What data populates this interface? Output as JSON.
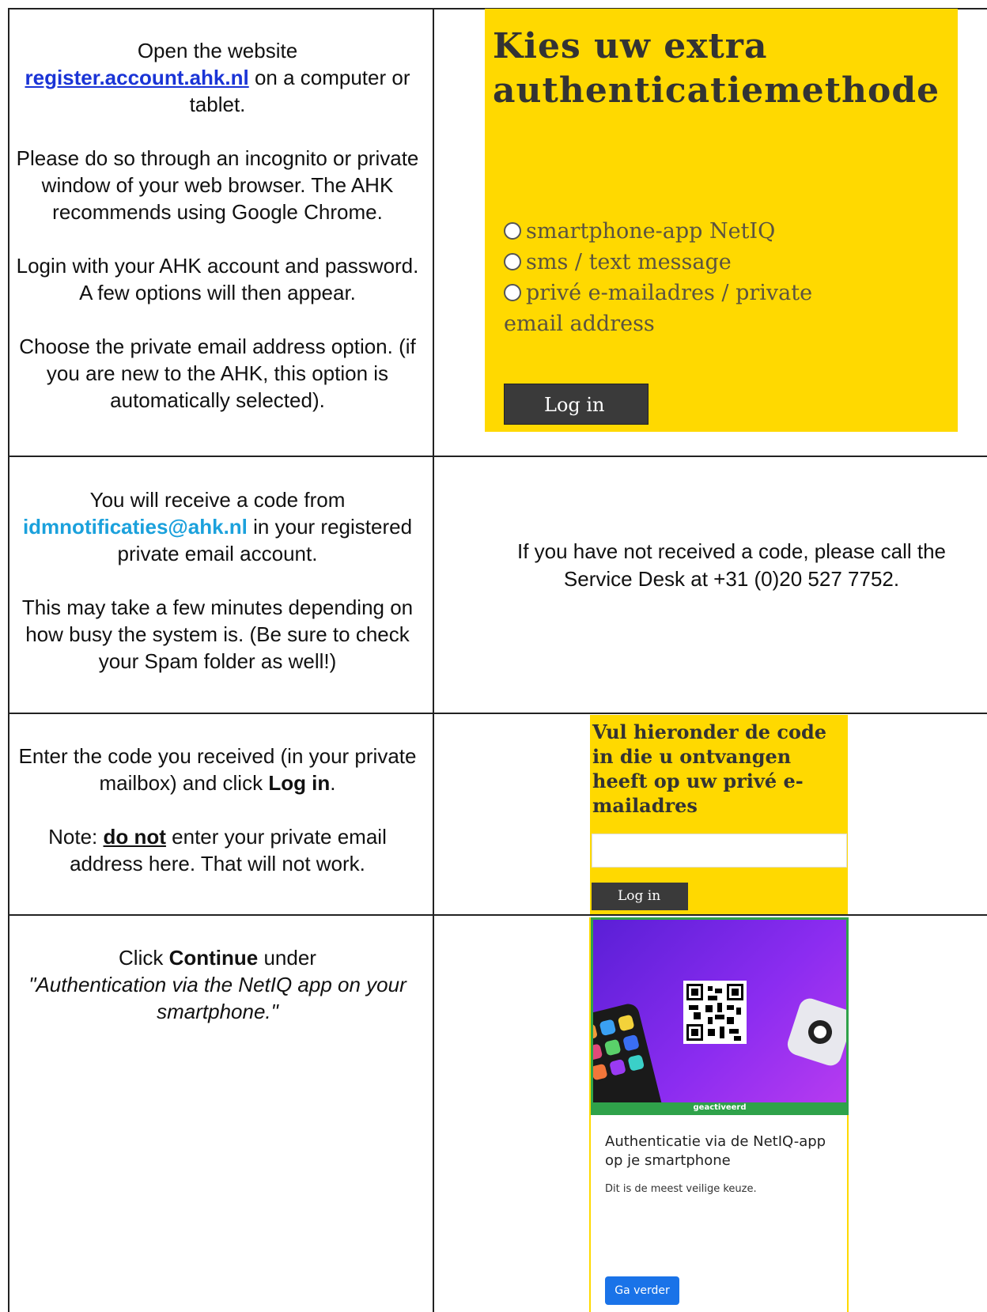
{
  "rows": [
    {
      "left": {
        "p1_before": "Open the website",
        "p1_link": "register.account.ahk.nl",
        "p1_after": " on a computer or tablet.",
        "p2": "Please do so through an incognito or private window of your web browser. The AHK recommends using Google Chrome.",
        "p3": "Login with your AHK account and password. A few options will then appear.",
        "p4": "Choose the private email address option. (if you are new to the AHK, this option is automatically selected)."
      },
      "right_panel": {
        "title": "Kies uw extra authenticatiemethode",
        "options": [
          "smartphone-app NetIQ",
          "sms / text message",
          "privé e-mailadres / private email address"
        ],
        "login_button": "Log in",
        "background": "#ffd900"
      }
    },
    {
      "left": {
        "p1_before": "You will receive a code from ",
        "p1_email": "idmnotificaties@ahk.nl",
        "p1_after": " in your registered private email account.",
        "p2": "This may take a few minutes depending on how busy the system is. (Be sure to check your Spam folder as well!)"
      },
      "right_text": "If you have not received a code, please call the Service Desk at +31 (0)20 527 7752."
    },
    {
      "left": {
        "p1_before": "Enter the code you received (in your private mailbox) and click ",
        "p1_bold": "Log in",
        "p1_after": ".",
        "p2_before": "Note: ",
        "p2_bold": "do not",
        "p2_after": " enter your private email address here. That will not work."
      },
      "right_panel": {
        "title": "Vul hieronder de code in die u ontvangen heeft op uw privé e-mailadres",
        "code_input_value": "",
        "login_button": "Log in"
      }
    },
    {
      "left": {
        "p1_before": "Click ",
        "p1_bold": "Continue",
        "p1_mid": " under ",
        "p1_italic": "\"Authentication via the NetIQ app on your smartphone.\""
      },
      "right_card": {
        "badge": "geactiveerd",
        "title": "Authenticatie via de NetIQ-app op je smartphone",
        "subtitle": "Dit is de meest veilige keuze.",
        "button": "Ga verder",
        "accent": "#1a73e8",
        "badge_color": "#2fa24a"
      }
    }
  ]
}
